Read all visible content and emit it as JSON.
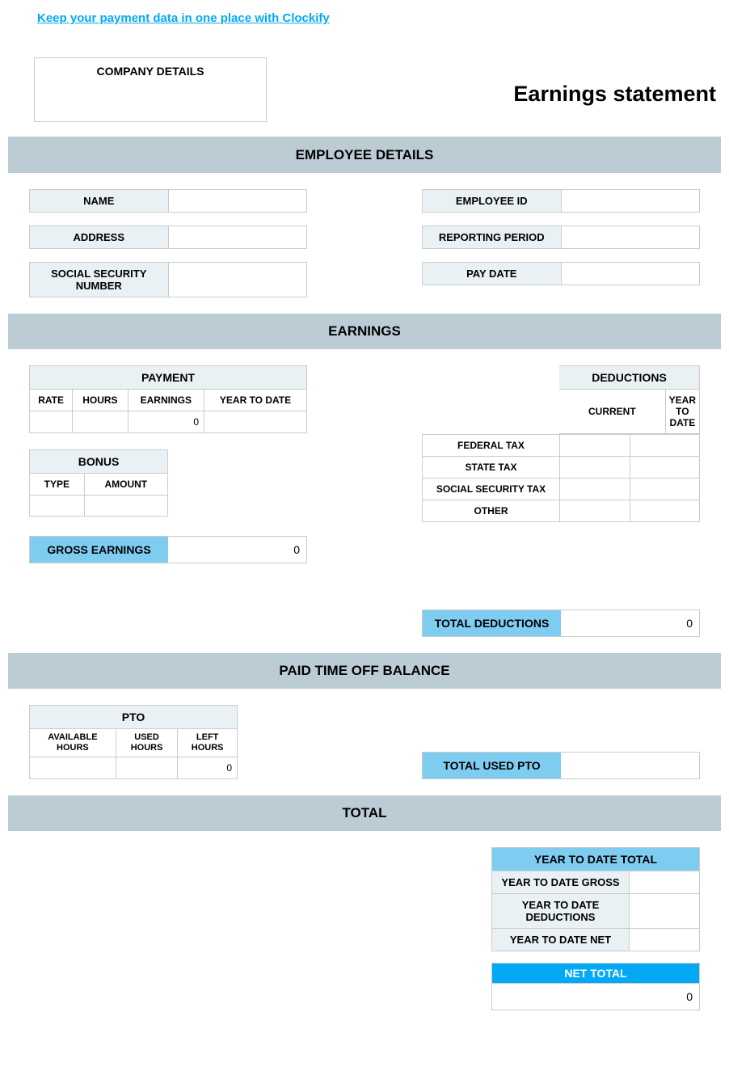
{
  "top_link": "Keep your payment data in one place with Clockify",
  "company_box": "COMPANY DETAILS",
  "title": "Earnings statement",
  "sections": {
    "employee": "EMPLOYEE DETAILS",
    "earnings": "EARNINGS",
    "pto": "PAID TIME OFF BALANCE",
    "total": "TOTAL"
  },
  "employee_fields": {
    "name": {
      "label": "NAME",
      "value": ""
    },
    "employee_id": {
      "label": "EMPLOYEE ID",
      "value": ""
    },
    "address": {
      "label": "ADDRESS",
      "value": ""
    },
    "reporting_period": {
      "label": "REPORTING PERIOD",
      "value": ""
    },
    "ssn": {
      "label": "SOCIAL SECURITY NUMBER",
      "value": ""
    },
    "pay_date": {
      "label": "PAY DATE",
      "value": ""
    }
  },
  "payment": {
    "header": "PAYMENT",
    "cols": {
      "rate": "RATE",
      "hours": "HOURS",
      "earnings": "EARNINGS",
      "ytd": "YEAR TO DATE"
    },
    "row": {
      "rate": "",
      "hours": "",
      "earnings": "0",
      "ytd": ""
    }
  },
  "bonus": {
    "header": "BONUS",
    "cols": {
      "type": "TYPE",
      "amount": "AMOUNT"
    },
    "row": {
      "type": "",
      "amount": ""
    }
  },
  "deductions": {
    "header": "DEDUCTIONS",
    "cols": {
      "current": "CURRENT",
      "ytd": "YEAR TO DATE"
    },
    "rows": [
      {
        "label": "FEDERAL TAX",
        "current": "",
        "ytd": ""
      },
      {
        "label": "STATE TAX",
        "current": "",
        "ytd": ""
      },
      {
        "label": "SOCIAL SECURITY TAX",
        "current": "",
        "ytd": ""
      },
      {
        "label": "OTHER",
        "current": "",
        "ytd": ""
      }
    ]
  },
  "gross_earnings": {
    "label": "GROSS EARNINGS",
    "value": "0"
  },
  "total_deductions": {
    "label": "TOTAL DEDUCTIONS",
    "value": "0"
  },
  "pto": {
    "header": "PTO",
    "cols": {
      "avail": "AVAILABLE HOURS",
      "used": "USED HOURS",
      "left": "LEFT HOURS"
    },
    "row": {
      "avail": "",
      "used": "",
      "left": "0"
    }
  },
  "total_used_pto": {
    "label": "TOTAL USED PTO",
    "value": ""
  },
  "ytd_total": {
    "header": "YEAR TO DATE TOTAL",
    "gross": {
      "label": "YEAR TO DATE GROSS",
      "value": ""
    },
    "deductions": {
      "label": "YEAR TO DATE DEDUCTIONS",
      "value": ""
    },
    "net": {
      "label": "YEAR TO DATE NET",
      "value": ""
    }
  },
  "net_total": {
    "label": "NET TOTAL",
    "value": "0"
  }
}
